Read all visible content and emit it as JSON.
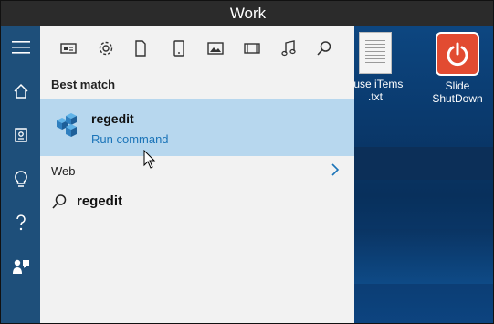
{
  "window": {
    "title": "Work"
  },
  "desktop": {
    "icons": [
      {
        "label_line1": "ouse iTems",
        "label_line2": ".txt",
        "icon": "text-file-icon"
      },
      {
        "label_line1": "Slide",
        "label_line2": "ShutDown",
        "icon": "power-icon"
      }
    ]
  },
  "sidebar": {
    "items": [
      {
        "icon": "hamburger-menu-icon"
      },
      {
        "icon": "home-icon"
      },
      {
        "icon": "notebook-icon"
      },
      {
        "icon": "lightbulb-icon"
      },
      {
        "icon": "help-icon"
      },
      {
        "icon": "feedback-icon"
      }
    ]
  },
  "filters": [
    {
      "icon": "apps-icon"
    },
    {
      "icon": "settings-icon"
    },
    {
      "icon": "document-icon"
    },
    {
      "icon": "tablet-icon"
    },
    {
      "icon": "photo-icon"
    },
    {
      "icon": "video-icon"
    },
    {
      "icon": "music-icon"
    },
    {
      "icon": "search-icon"
    }
  ],
  "results": {
    "best_match_label": "Best match",
    "best_match": {
      "title": "regedit",
      "subtitle": "Run command",
      "icon": "regedit-icon"
    },
    "web_label": "Web",
    "web_item": {
      "label": "regedit",
      "icon": "search-icon"
    }
  },
  "colors": {
    "highlight": "#b7d7ee",
    "accent": "#1b74b8",
    "rail": "#1e4f7a",
    "panel": "#f2f2f2"
  }
}
